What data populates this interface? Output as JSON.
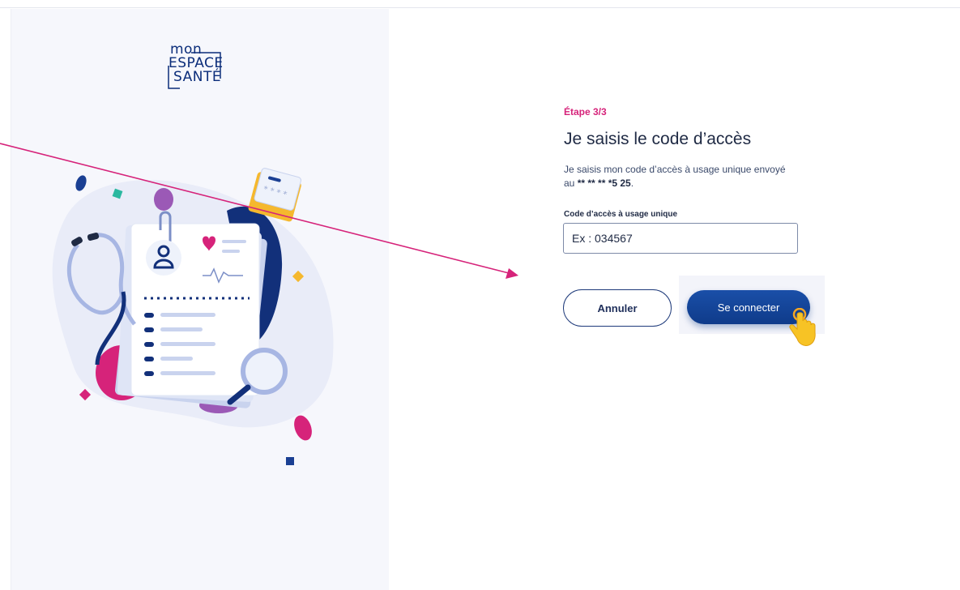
{
  "logo": {
    "line1": "mon",
    "line2": "ESPACE",
    "line3": "SANTÉ"
  },
  "form": {
    "step": "Étape 3/3",
    "title": "Je saisis le code d’accès",
    "description_prefix": "Je saisis mon code d’accès à usage unique envoyé au ",
    "phone_masked": "** ** ** *5 25",
    "description_suffix": ".",
    "code_label": "Code d’accès à usage unique",
    "code_placeholder": "Ex : 034567",
    "code_value": ""
  },
  "buttons": {
    "cancel_label": "Annuler",
    "connect_label": "Se connecter"
  },
  "colors": {
    "accent_pink": "#d6237a",
    "brand_blue": "#0f3b8a",
    "panel_bg": "#f6f7fc"
  }
}
